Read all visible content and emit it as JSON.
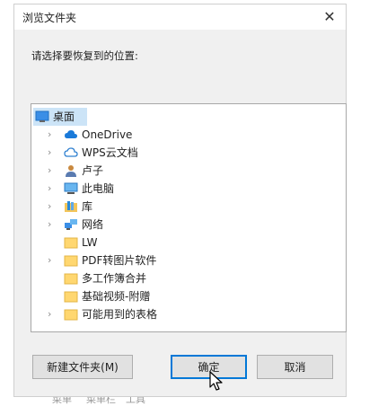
{
  "window": {
    "title": "浏览文件夹",
    "close_glyph": "✕"
  },
  "prompt": "请选择要恢复到的位置:",
  "tree": {
    "items": [
      {
        "label": "桌面",
        "icon": "desktop-icon",
        "expandable": false,
        "selected": true
      },
      {
        "label": "OneDrive",
        "icon": "cloud-icon",
        "expandable": true
      },
      {
        "label": "WPS云文档",
        "icon": "wps-cloud-icon",
        "expandable": true
      },
      {
        "label": "卢子",
        "icon": "user-icon",
        "expandable": true
      },
      {
        "label": "此电脑",
        "icon": "computer-icon",
        "expandable": true
      },
      {
        "label": "库",
        "icon": "library-icon",
        "expandable": true
      },
      {
        "label": "网络",
        "icon": "network-icon",
        "expandable": true
      },
      {
        "label": "LW",
        "icon": "folder-icon",
        "expandable": false
      },
      {
        "label": "PDF转图片软件",
        "icon": "folder-icon",
        "expandable": true
      },
      {
        "label": "多工作簿合并",
        "icon": "folder-icon",
        "expandable": false
      },
      {
        "label": "基础视频-附赠",
        "icon": "folder-icon",
        "expandable": false
      },
      {
        "label": "可能用到的表格",
        "icon": "folder-icon",
        "expandable": true
      }
    ]
  },
  "buttons": {
    "new_folder": "新建文件夹(M)",
    "ok": "确定",
    "cancel": "取消"
  },
  "colors": {
    "accent": "#0078d7",
    "folder": "#ffd770",
    "selected_bg": "#cce4f7"
  },
  "background_text": [
    "菜单",
    "菜单栏",
    "工具"
  ]
}
